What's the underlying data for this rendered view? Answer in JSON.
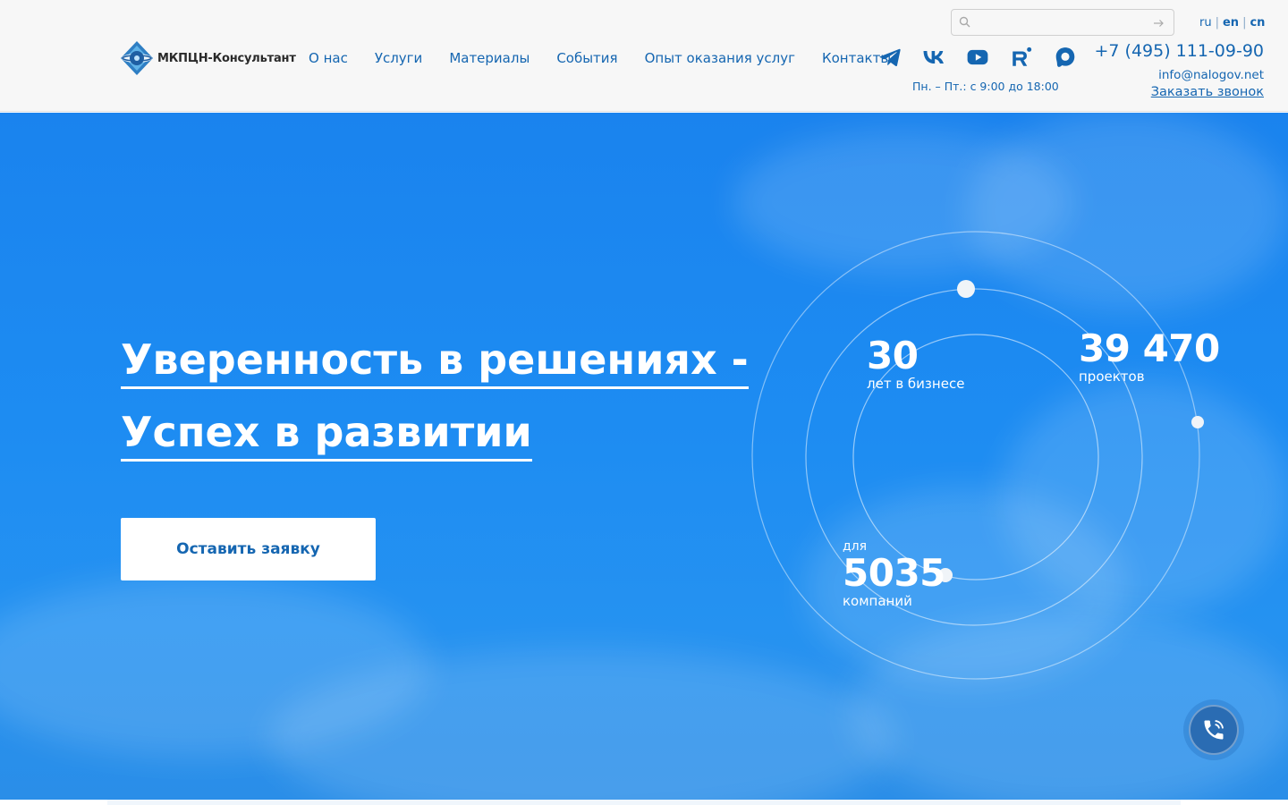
{
  "brand": {
    "name": "МКПЦН-Консультант",
    "logo_icon": "mkpcn-logo-icon"
  },
  "nav": [
    {
      "label": "О нас"
    },
    {
      "label": "Услуги"
    },
    {
      "label": "Материалы"
    },
    {
      "label": "События"
    },
    {
      "label": "Опыт оказания услуг"
    },
    {
      "label": "Контакты"
    }
  ],
  "socials": [
    {
      "icon": "telegram-icon"
    },
    {
      "icon": "vk-icon"
    },
    {
      "icon": "youtube-icon"
    },
    {
      "icon": "rutube-icon"
    },
    {
      "icon": "max-messenger-icon"
    }
  ],
  "search": {
    "placeholder": "",
    "value": ""
  },
  "languages": [
    {
      "code": "ru",
      "active": false
    },
    {
      "code": "en",
      "active": true
    },
    {
      "code": "cn",
      "active": false
    }
  ],
  "contacts": {
    "phone": "+7 (495) 111-09-90",
    "email": "info@nalogov.net",
    "callback_label": "Заказать звонок",
    "hours": "Пн. – Пт.: с 9:00 до 18:00"
  },
  "hero": {
    "line1_bold": "Уверенность",
    "line1_rest": " в решениях -",
    "line2_bold": "Успех",
    "line2_rest": " в развитии",
    "cta_label": "Оставить заявку"
  },
  "stats": {
    "years": {
      "value": "30",
      "label": "лет в бизнесе"
    },
    "projects": {
      "value": "39 470",
      "label": "проектов"
    },
    "companies": {
      "prefix": "для",
      "value": "5035",
      "label": "компаний"
    }
  },
  "colors": {
    "accent": "#1566b1",
    "hero_blue": "#1d8cf2",
    "header_bg": "#f7f7f7",
    "fab": "#2a6cb3"
  }
}
